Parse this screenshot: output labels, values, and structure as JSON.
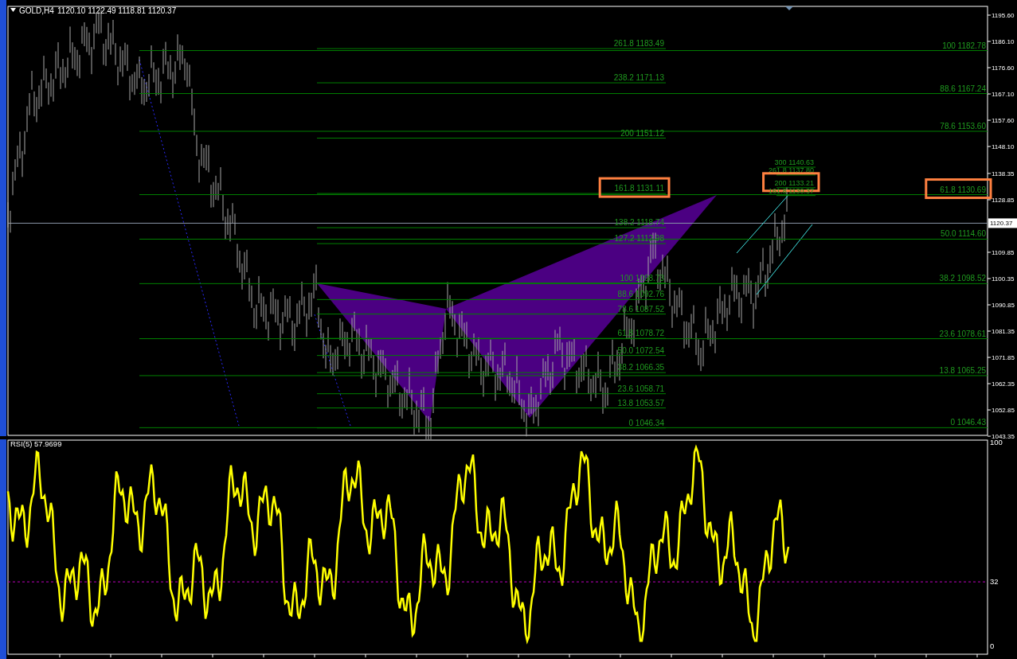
{
  "header": {
    "symbol": "GOLD,H4",
    "quotes": "1120.10 1122.49 1118.81 1120.37"
  },
  "price_axis": {
    "ticks": [
      "1195.60",
      "1186.10",
      "1176.60",
      "1167.10",
      "1157.60",
      "1148.10",
      "1138.35",
      "1128.85",
      "1109.85",
      "1100.35",
      "1090.85",
      "1081.35",
      "1071.85",
      "1062.35",
      "1052.85",
      "1043.35"
    ],
    "current_price": "1120.37"
  },
  "fibonacci_retracement": [
    {
      "ratio": "100",
      "value": "1182.78",
      "highlighted": false
    },
    {
      "ratio": "88.6",
      "value": "1167.24",
      "highlighted": false
    },
    {
      "ratio": "78.6",
      "value": "1153.60",
      "highlighted": false
    },
    {
      "ratio": "61.8",
      "value": "1130.69",
      "highlighted": true
    },
    {
      "ratio": "50.0",
      "value": "1114.60",
      "highlighted": false
    },
    {
      "ratio": "38.2",
      "value": "1098.52",
      "highlighted": false
    },
    {
      "ratio": "23.6",
      "value": "1078.61",
      "highlighted": false
    },
    {
      "ratio": "13.8",
      "value": "1065.25",
      "highlighted": false
    },
    {
      "ratio": "0",
      "value": "1046.43",
      "highlighted": false
    }
  ],
  "fibonacci_extension": [
    {
      "ratio": "261.8",
      "value": "1183.49",
      "highlighted": false
    },
    {
      "ratio": "238.2",
      "value": "1171.13",
      "highlighted": false
    },
    {
      "ratio": "200",
      "value": "1151.12",
      "highlighted": false
    },
    {
      "ratio": "161.8",
      "value": "1131.11",
      "highlighted": true
    },
    {
      "ratio": "138.2",
      "value": "1118.74",
      "highlighted": false
    },
    {
      "ratio": "127.2",
      "value": "1112.98",
      "highlighted": false
    },
    {
      "ratio": "100",
      "value": "1098.73",
      "highlighted": false
    },
    {
      "ratio": "88.6",
      "value": "1092.76",
      "highlighted": false
    },
    {
      "ratio": "78.6",
      "value": "1087.52",
      "highlighted": false
    },
    {
      "ratio": "61.8",
      "value": "1078.72",
      "highlighted": false
    },
    {
      "ratio": "50.0",
      "value": "1072.54",
      "highlighted": false
    },
    {
      "ratio": "38.2",
      "value": "1066.35",
      "highlighted": false
    },
    {
      "ratio": "23.6",
      "value": "1058.71",
      "highlighted": false
    },
    {
      "ratio": "13.8",
      "value": "1053.57",
      "highlighted": false
    },
    {
      "ratio": "0",
      "value": "1046.34",
      "highlighted": false
    }
  ],
  "fibonacci_cluster": [
    {
      "ratio": "300",
      "value": "1140.63",
      "highlighted": false
    },
    {
      "ratio": "261.8",
      "value": "1137.80",
      "highlighted": false
    },
    {
      "ratio": "200",
      "value": "1133.21",
      "highlighted": true
    },
    {
      "ratio": "161.8",
      "value": "1130.37",
      "highlighted": false
    }
  ],
  "rsi": {
    "title": "RSI(5) 57.9699",
    "ticks": [
      "100",
      "32",
      "0"
    ]
  }
}
